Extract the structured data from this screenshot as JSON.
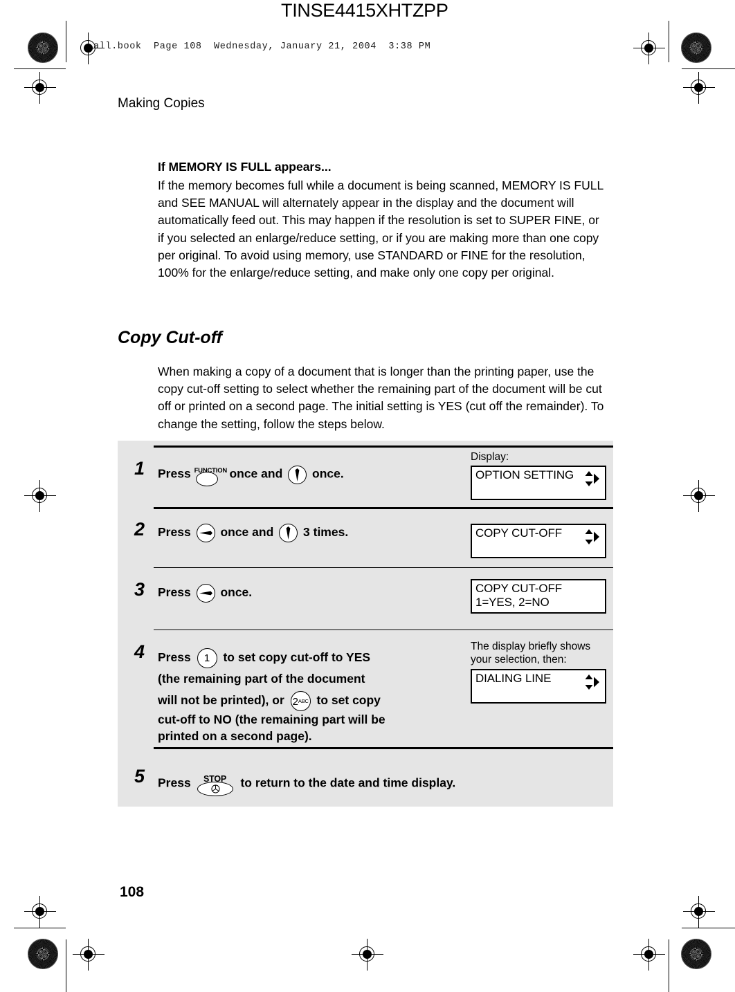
{
  "print_marks": {
    "book_line": "all.book  Page 108  Wednesday, January 21, 2004  3:38 PM",
    "doc_code": "TINSE4415XHTZPP"
  },
  "running_head": "Making Copies",
  "memory_note": {
    "heading": "If MEMORY IS FULL appears...",
    "body": "If the memory becomes full while a document is being scanned, MEMORY IS FULL and SEE MANUAL will alternately appear in the display and the document will automatically feed out. This may happen if the resolution is set to SUPER FINE, or if you selected an enlarge/reduce setting, or if you are making more than one copy per original. To avoid using memory, use STANDARD or FINE for the resolution, 100% for the enlarge/reduce setting, and make only one copy per original."
  },
  "section": {
    "title": "Copy Cut-off",
    "intro": "When making a copy of a document that is longer than the printing paper, use the copy cut-off setting to select whether the remaining part of the document will be cut off or printed on a second page. The initial setting is YES (cut off the remainder). To change the setting, follow the steps below."
  },
  "procedure": {
    "display_label": "Display:",
    "note_step4": "The display briefly shows your selection, then:",
    "steps": [
      {
        "number": "1",
        "text_a": "Press",
        "key1": "FUNCTION",
        "text_b": "once and",
        "key2": "down-arrow",
        "text_c": "once.",
        "lcd": {
          "line1": "OPTION SETTING",
          "line2": ""
        }
      },
      {
        "number": "2",
        "text_a": "Press",
        "key1": "right-arrow",
        "text_b": "once and",
        "key2": "down-arrow",
        "text_c": "3 times.",
        "lcd": {
          "line1": "COPY CUT-OFF",
          "line2": ""
        }
      },
      {
        "number": "3",
        "text_a": "Press",
        "key1": "right-arrow",
        "text_b": "",
        "key2": "",
        "text_c": "once.",
        "lcd": {
          "line1": "COPY CUT-OFF",
          "line2": "1=YES, 2=NO"
        }
      },
      {
        "number": "4",
        "text_a": "Press",
        "key1": "1",
        "text_b": "to set copy cut-off to YES",
        "line2": "(the remaining part of the document",
        "line3_a": "will not be printed), or",
        "key2": "2ABC",
        "line3_b": "to set copy",
        "line4": "cut-off to NO (the remaining part will be",
        "line5": "printed on a second page).",
        "lcd": {
          "line1": "DIALING LINE",
          "line2": ""
        }
      },
      {
        "number": "5",
        "text_a": "Press",
        "key1": "STOP",
        "text_b": "to return to the date and time display.",
        "lcd": null
      }
    ]
  },
  "folio": "108",
  "colors": {
    "panel_bg": "#e5e5e5",
    "rule": "#000000",
    "lcd_bg": "#ffffff"
  }
}
